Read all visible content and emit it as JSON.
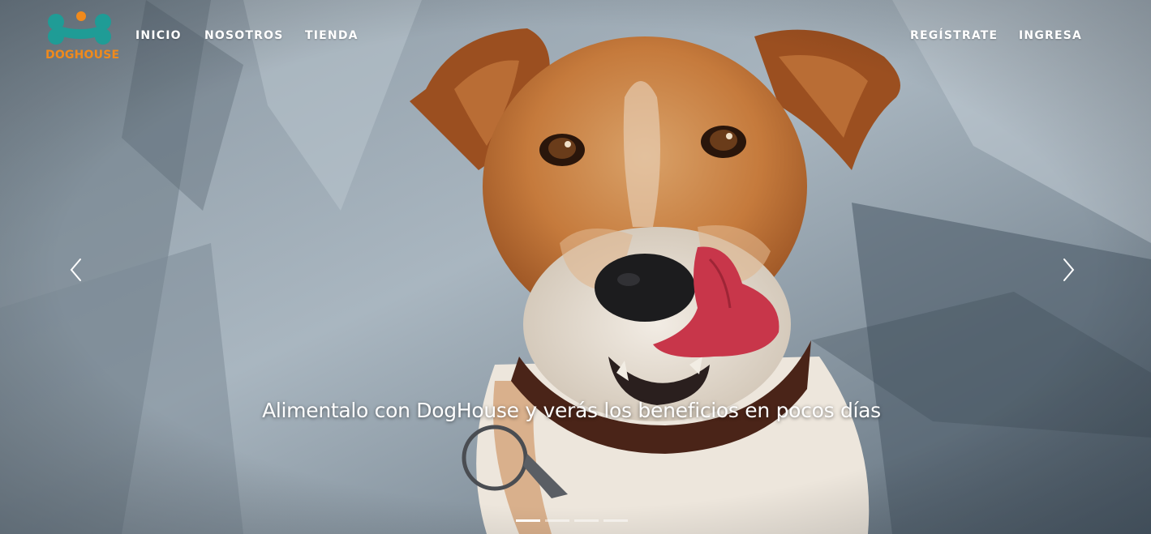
{
  "brand": {
    "name": "DOGHOUSE",
    "logo_icon": "bone-icon",
    "colors": {
      "bone": "#1f9c96",
      "dot": "#f08a1c",
      "text": "#f08a1c"
    }
  },
  "nav": {
    "left": [
      {
        "label": "INICIO"
      },
      {
        "label": "NOSOTROS"
      },
      {
        "label": "TIENDA"
      }
    ],
    "right": [
      {
        "label": "REGÍSTRATE"
      },
      {
        "label": "INGRESA"
      }
    ]
  },
  "carousel": {
    "caption": "Alimentalo con DogHouse y verás los beneficios en pocos días",
    "prev_icon": "chevron-left-icon",
    "next_icon": "chevron-right-icon",
    "slide_count": 4,
    "active_slide": 1,
    "hero_image": "dog-licking-nose-photo"
  }
}
